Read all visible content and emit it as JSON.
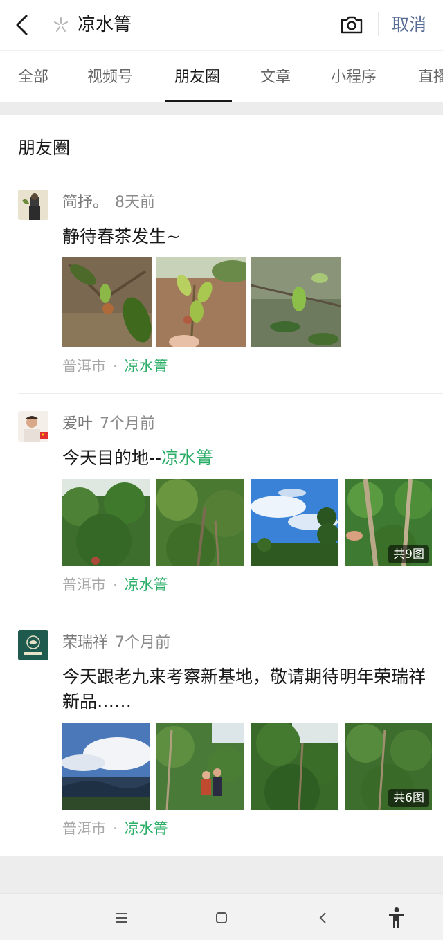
{
  "header": {
    "query": "凉水箐",
    "cancel_label": "取消"
  },
  "tabs": [
    {
      "label": "全部"
    },
    {
      "label": "视频号"
    },
    {
      "label": "朋友圈"
    },
    {
      "label": "文章"
    },
    {
      "label": "小程序"
    },
    {
      "label": "直播"
    }
  ],
  "active_tab": "朋友圈",
  "section": {
    "title": "朋友圈"
  },
  "posts": [
    {
      "author": "简抒。",
      "time": "8天前",
      "text": "静待春茶发生~",
      "text_highlight": "",
      "location": "普洱市",
      "separator": "·",
      "place_tag": "凉水箐",
      "image_count_label": ""
    },
    {
      "author": "爱叶",
      "time": "7个月前",
      "text": "今天目的地--",
      "text_highlight": "凉水箐",
      "location": "普洱市",
      "separator": "·",
      "place_tag": "凉水箐",
      "image_count_label": "共9图"
    },
    {
      "author": "荣瑞祥",
      "time": "7个月前",
      "text": "今天跟老九来考察新基地，敬请期待明年荣瑞祥新品……",
      "text_highlight": "",
      "location": "普洱市",
      "separator": "·",
      "place_tag": "凉水箐",
      "image_count_label": "共6图"
    }
  ],
  "colors": {
    "accent_green": "#2aae67",
    "link_blue": "#576b95"
  },
  "icons": [
    "back-arrow-icon",
    "search-icon",
    "camera-icon",
    "menu-icon",
    "home-square-icon",
    "back-chevron-icon",
    "accessibility-icon"
  ]
}
